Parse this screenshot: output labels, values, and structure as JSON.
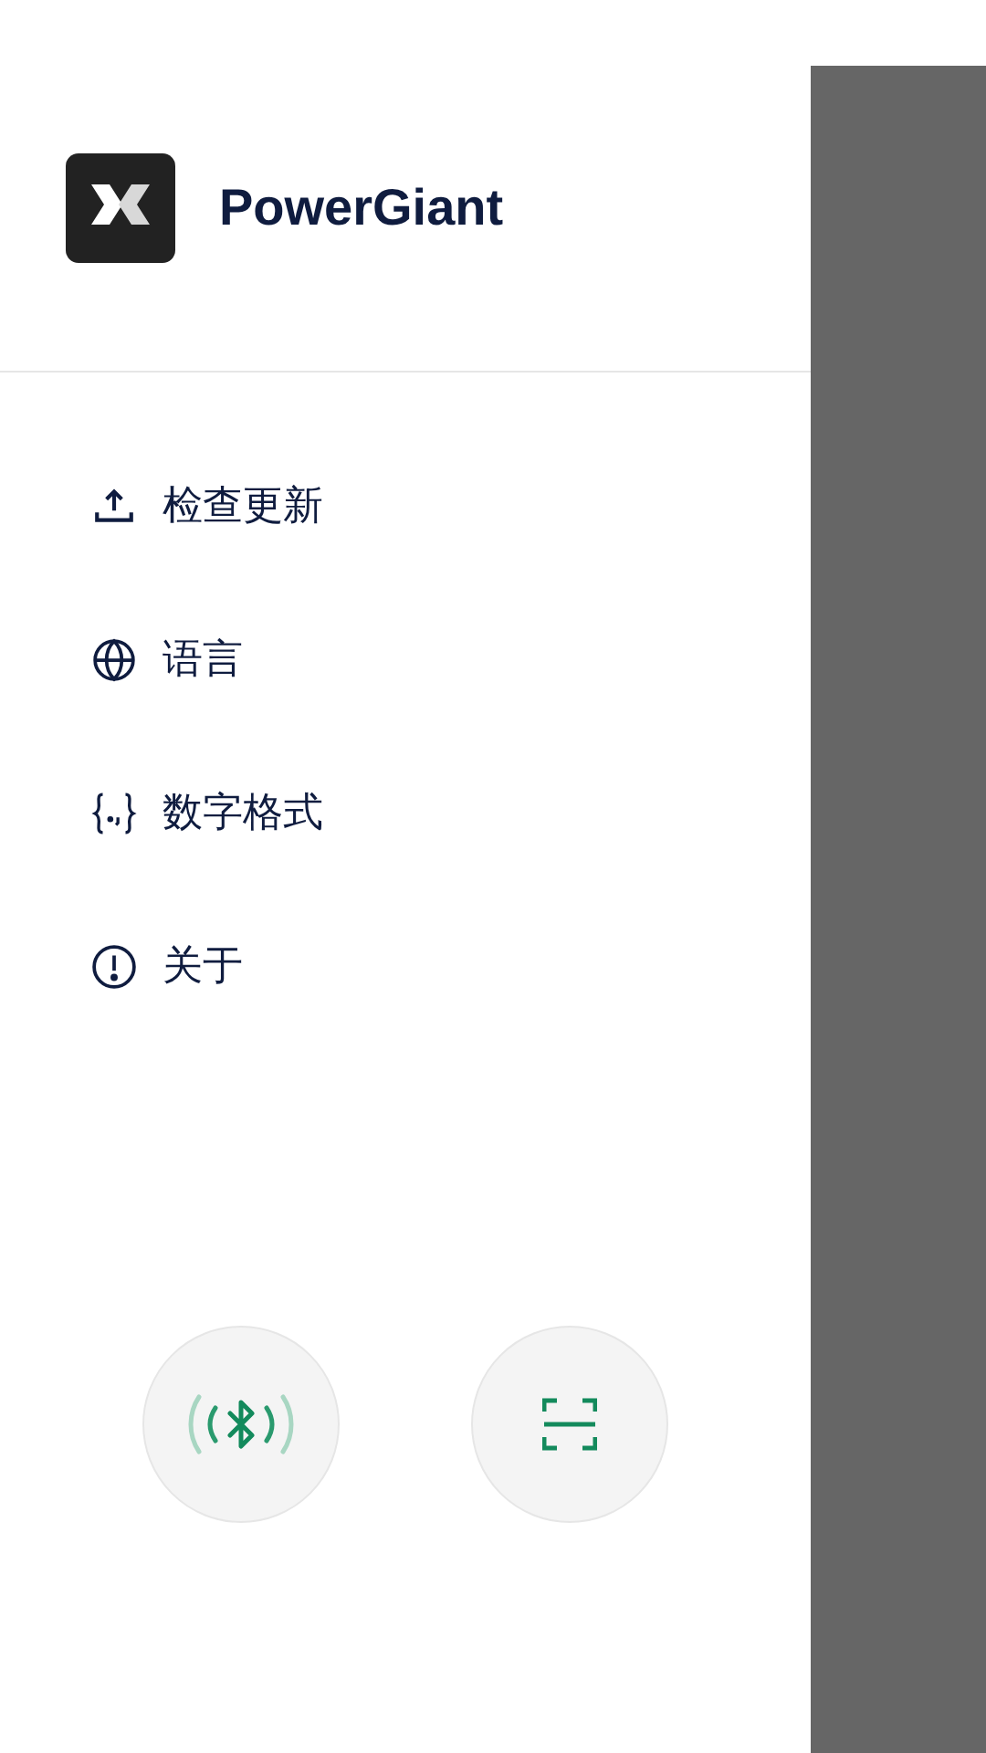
{
  "drawer": {
    "app_name": "PowerGiant",
    "menu": [
      {
        "kind": "update",
        "label": "检查更新"
      },
      {
        "kind": "language",
        "label": "语言"
      },
      {
        "kind": "number_format",
        "label": "数字格式"
      },
      {
        "kind": "about",
        "label": "关于"
      }
    ],
    "actions": [
      {
        "kind": "bluetooth"
      },
      {
        "kind": "scan"
      }
    ]
  }
}
